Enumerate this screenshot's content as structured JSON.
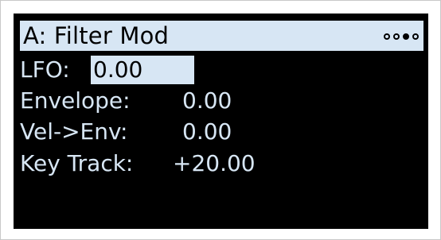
{
  "header": {
    "title": "A: Filter Mod",
    "page_indicator": {
      "total": 4,
      "current": 3
    }
  },
  "params": [
    {
      "label": "LFO:",
      "value": "0.00",
      "selected": true
    },
    {
      "label": "Envelope:",
      "value": "0.00",
      "selected": false
    },
    {
      "label": "Vel->Env:",
      "value": "0.00",
      "selected": false
    },
    {
      "label": "Key Track:",
      "value": "+20.00",
      "selected": false
    }
  ],
  "colors": {
    "screen_bg": "#000000",
    "highlight": "#d7e6f4",
    "text": "#d7e6f4"
  }
}
